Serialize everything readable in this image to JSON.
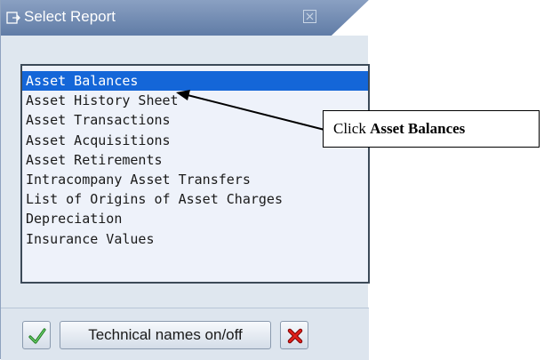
{
  "dialog": {
    "title": "Select Report",
    "title_icon": "report-select-icon",
    "close_icon": "close-icon",
    "accent_color": "#1466d8"
  },
  "report_list": {
    "items": [
      "Asset Balances",
      "Asset History Sheet",
      "Asset Transactions",
      "Asset Acquisitions",
      "Asset Retirements",
      "Intracompany Asset Transfers",
      "List of Origins of Asset Charges",
      "Depreciation",
      "Insurance Values"
    ],
    "selected": "Asset Balances"
  },
  "footer": {
    "ok_icon": "checkmark-icon",
    "technical_names_label": "Technical names on/off",
    "cancel_icon": "cancel-x-icon"
  },
  "callout": {
    "prefix": "Click ",
    "emphasis": "Asset Balances"
  }
}
